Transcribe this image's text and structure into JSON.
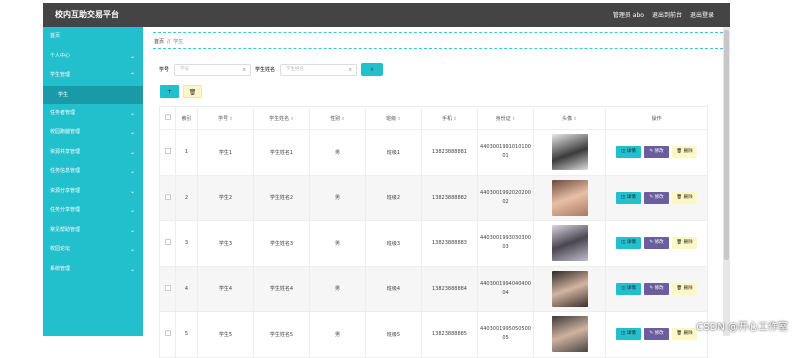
{
  "header": {
    "title": "校内互助交易平台",
    "user_label": "管理员 abo",
    "back_label": "退出到前台",
    "logout_label": "退出登录"
  },
  "sidebar": {
    "items": [
      {
        "label": "首页",
        "chevron": false
      },
      {
        "label": "个人中心",
        "chevron": true
      },
      {
        "label": "学生管理",
        "chevron": true
      },
      {
        "label": "学生",
        "chevron": false,
        "active": true
      },
      {
        "label": "任务者管理",
        "chevron": true
      },
      {
        "label": "校园跑腿管理",
        "chevron": true
      },
      {
        "label": "资源共享管理",
        "chevron": true
      },
      {
        "label": "任务信息管理",
        "chevron": true
      },
      {
        "label": "资源分享管理",
        "chevron": true
      },
      {
        "label": "任务分享管理",
        "chevron": true
      },
      {
        "label": "常见帮助管理",
        "chevron": true
      },
      {
        "label": "校园论坛",
        "chevron": true
      },
      {
        "label": "系统管理",
        "chevron": true
      }
    ]
  },
  "breadcrumb": {
    "home": "首页",
    "separator": "//",
    "current": "学生"
  },
  "search": {
    "field1_label": "学号",
    "field1_placeholder": "学号",
    "field2_label": "学生姓名",
    "field2_placeholder": "学生姓名",
    "search_icon": "search-icon",
    "search_button_glyph": "⌕"
  },
  "actions": {
    "add_glyph": "+",
    "delete_glyph": "🗑"
  },
  "table": {
    "headers": [
      "索引",
      "学号",
      "学生姓名",
      "性别",
      "班级",
      "手机",
      "身份证",
      "头像",
      "操作"
    ],
    "rows": [
      {
        "index": "1",
        "student_no": "学生1",
        "name": "学生姓名1",
        "gender": "男",
        "class": "班级1",
        "phone": "13823888881",
        "id_card_1": "4403001991010100",
        "id_card_2": "01",
        "avatar_color": "#3a3a3a"
      },
      {
        "index": "2",
        "student_no": "学生2",
        "name": "学生姓名2",
        "gender": "男",
        "class": "班级2",
        "phone": "13823888882",
        "id_card_1": "4403001992020200",
        "id_card_2": "02",
        "avatar_color": "#c89a84"
      },
      {
        "index": "3",
        "student_no": "学生3",
        "name": "学生姓名3",
        "gender": "男",
        "class": "班级3",
        "phone": "13823888883",
        "id_card_1": "4403001993030300",
        "id_card_2": "03",
        "avatar_color": "#8d8a96"
      },
      {
        "index": "4",
        "student_no": "学生4",
        "name": "学生姓名4",
        "gender": "男",
        "class": "班级4",
        "phone": "13823888884",
        "id_card_1": "4403001994040400",
        "id_card_2": "04",
        "avatar_color": "#6f5a4f"
      },
      {
        "index": "5",
        "student_no": "学生5",
        "name": "学生姓名5",
        "gender": "男",
        "class": "班级5",
        "phone": "13823888885",
        "id_card_1": "4403001995050500",
        "id_card_2": "05",
        "avatar_color": "#4a4a4a"
      }
    ],
    "op_detail": "◫ 详情",
    "op_edit": "✎ 修改",
    "op_delete": "🗑 删除"
  },
  "watermark": "CSDN @开心工作室",
  "colors": {
    "accent": "#22bfcc",
    "topbar": "#444444",
    "edit": "#6b5e9c",
    "delete": "#fcf8c5"
  }
}
